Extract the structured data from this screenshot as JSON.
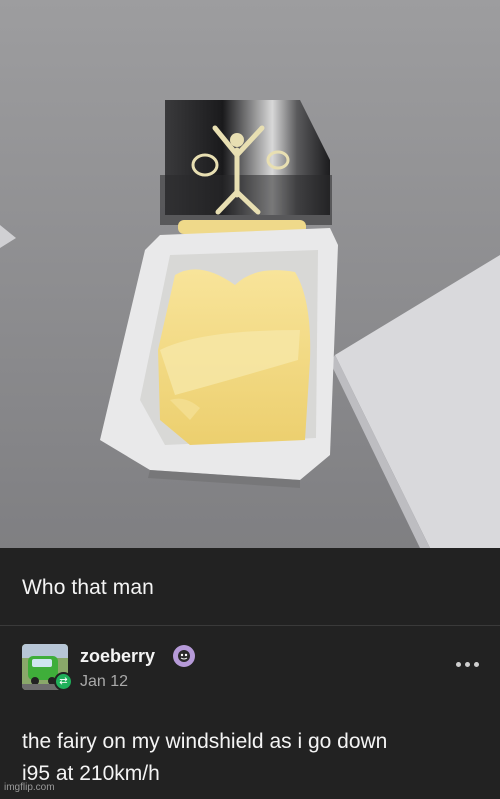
{
  "post": {
    "caption": "Who that man"
  },
  "reply": {
    "username": "zoeberry",
    "date": "Jan 12",
    "text_line1": "the fairy on my windshield as i go down",
    "text_line2": "i95 at 210km/h"
  },
  "icons": {
    "more": "more-horizontal-icon",
    "reblog": "reblog-icon",
    "user_badge": "badge-icon"
  },
  "watermark": "imgflip.com",
  "colors": {
    "background": "#222222",
    "text": "#f4f4f4",
    "muted": "#a9a9a9",
    "reblog_green": "#1fb05a",
    "badge_purple": "#b69ad8"
  }
}
